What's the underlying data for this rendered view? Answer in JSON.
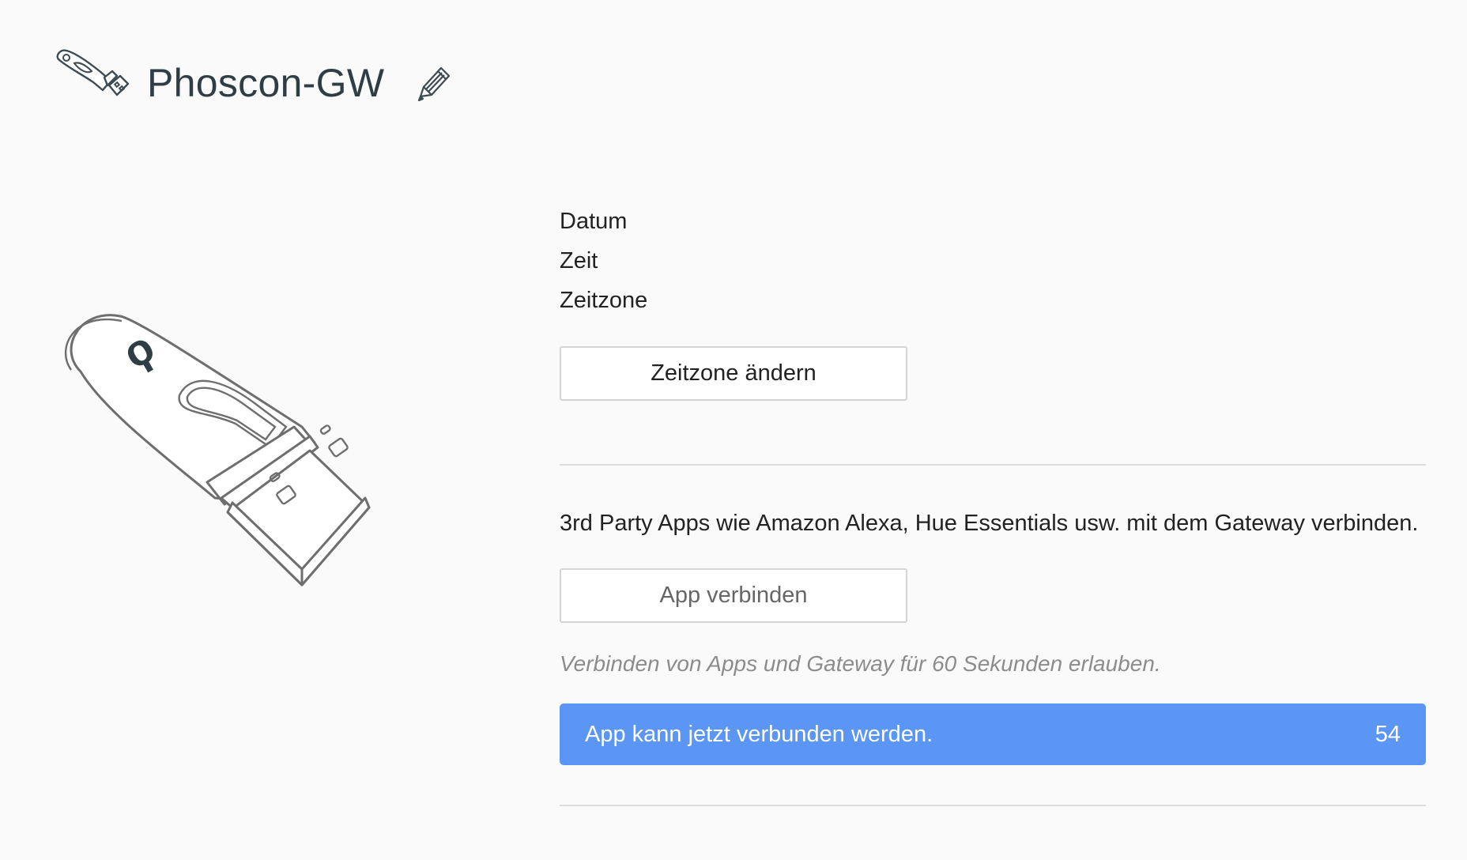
{
  "header": {
    "title": "Phoscon-GW",
    "icon": "usb-gateway-icon",
    "edit_icon": "pencil-icon"
  },
  "illustration": {
    "icon": "usb-stick-illustration",
    "logo_text": "ϙ"
  },
  "time_info": {
    "date_label": "Datum",
    "time_label": "Zeit",
    "timezone_label": "Zeitzone",
    "change_timezone_button": "Zeitzone ändern"
  },
  "apps": {
    "description": "3rd Party Apps wie Amazon Alexa, Hue Essentials usw. mit dem Gateway verbinden.",
    "connect_button": "App verbinden",
    "hint": "Verbinden von Apps und Gateway für 60 Sekunden erlauben.",
    "status_text": "App kann jetzt verbunden werden.",
    "countdown": "54"
  },
  "colors": {
    "accent": "#5b96f4",
    "background": "#fafafa",
    "title": "#2f3d44",
    "hint": "#8c8c8c"
  }
}
